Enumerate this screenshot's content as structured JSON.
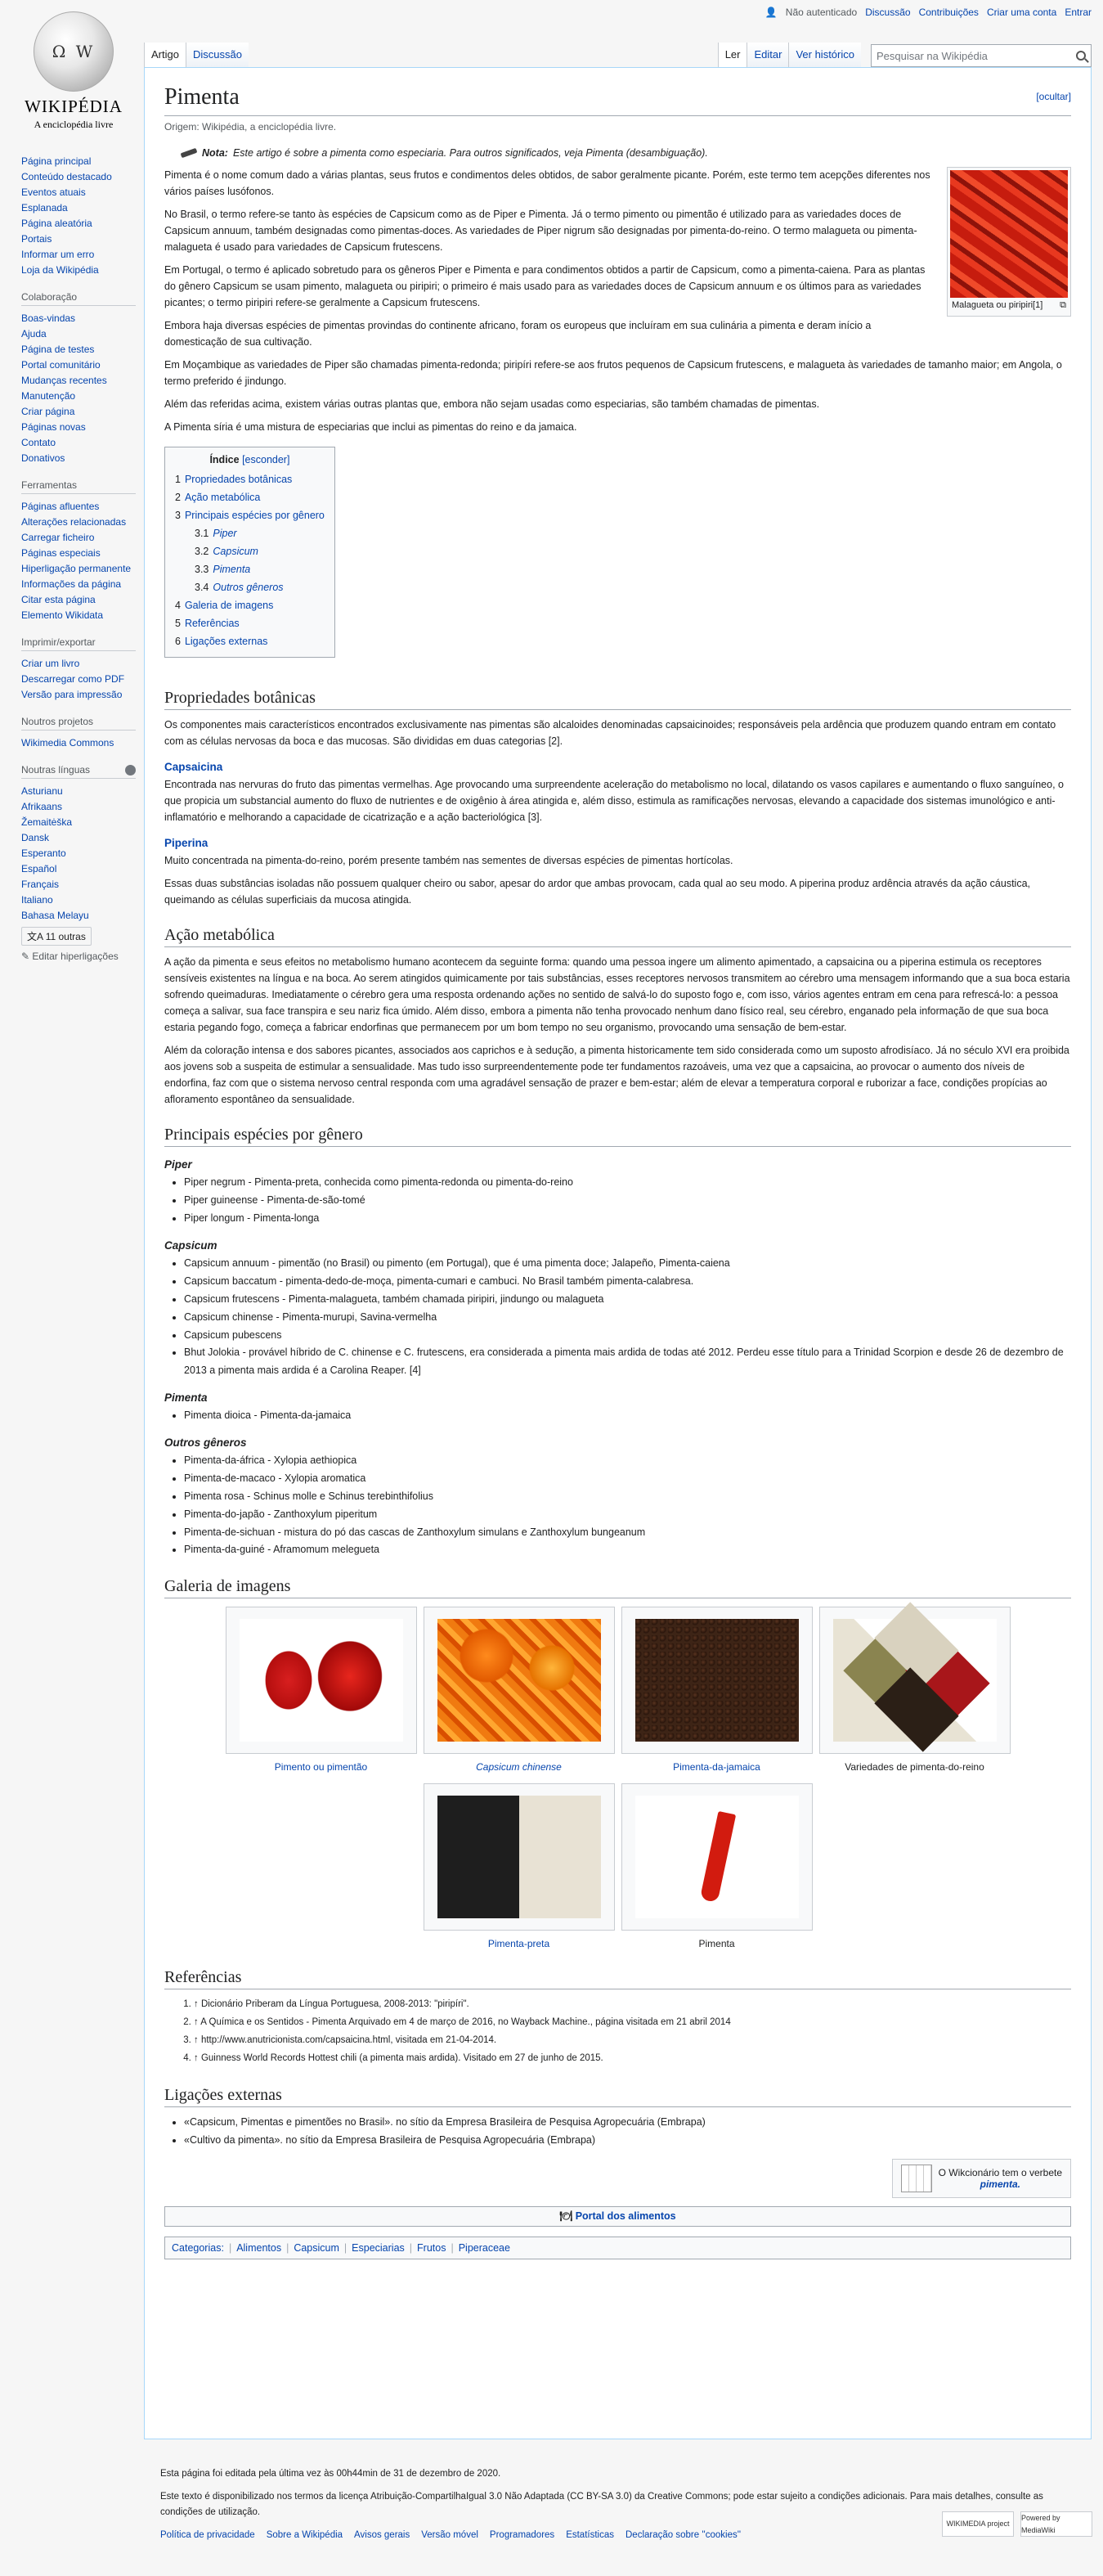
{
  "personal": {
    "not_logged": "Não autenticado",
    "discussion": "Discussão",
    "contributions": "Contribuições",
    "create_account": "Criar uma conta",
    "login": "Entrar"
  },
  "logo": {
    "name": "WIKIPÉDIA",
    "tagline": "A enciclopédia livre"
  },
  "sidebar": {
    "main": [
      "Página principal",
      "Conteúdo destacado",
      "Eventos atuais",
      "Esplanada",
      "Página aleatória",
      "Portais",
      "Informar um erro",
      "Loja da Wikipédia"
    ],
    "collab_title": "Colaboração",
    "collab": [
      "Boas-vindas",
      "Ajuda",
      "Página de testes",
      "Portal comunitário",
      "Mudanças recentes",
      "Manutenção",
      "Criar página",
      "Páginas novas",
      "Contato",
      "Donativos"
    ],
    "tools_title": "Ferramentas",
    "tools": [
      "Páginas afluentes",
      "Alterações relacionadas",
      "Carregar ficheiro",
      "Páginas especiais",
      "Hiperligação permanente",
      "Informações da página",
      "Citar esta página",
      "Elemento Wikidata"
    ],
    "print_title": "Imprimir/exportar",
    "print": [
      "Criar um livro",
      "Descarregar como PDF",
      "Versão para impressão"
    ],
    "projects_title": "Noutros projetos",
    "projects": [
      "Wikimedia Commons"
    ],
    "langs_title": "Noutras línguas",
    "langs": [
      "Asturianu",
      "Afrikaans",
      "Žemaitėška",
      "Dansk",
      "Esperanto",
      "Español",
      "Français",
      "Italiano",
      "Bahasa Melayu"
    ],
    "more_langs": "11 outras",
    "edit_links": "Editar hiperligações"
  },
  "tabs": {
    "article": "Artigo",
    "discussion": "Discussão",
    "read": "Ler",
    "edit": "Editar",
    "history": "Ver histórico",
    "search_placeholder": "Pesquisar na Wikipédia"
  },
  "title": "Pimenta",
  "hide": "[ocultar]",
  "sitesub": "Origem: Wikipédia, a enciclopédia livre.",
  "hatnote": {
    "label": "Nota:",
    "text": "Este artigo é sobre a pimenta como especiaria. Para outros significados, veja Pimenta (desambiguação)."
  },
  "infobox_caption": "Malagueta ou piripiri[1]",
  "intro": [
    "Pimenta é o nome comum dado a várias plantas, seus frutos e condimentos deles obtidos, de sabor geralmente picante. Porém, este termo tem acepções diferentes nos vários países lusófonos.",
    "No Brasil, o termo refere-se tanto às espécies de Capsicum como as de Piper e Pimenta. Já o termo pimento ou pimentão é utilizado para as variedades doces de Capsicum annuum, também designadas como pimentas-doces. As variedades de Piper nigrum são designadas por pimenta-do-reino. O termo malagueta ou pimenta-malagueta é usado para variedades de Capsicum frutescens.",
    "Em Portugal, o termo é aplicado sobretudo para os gêneros Piper e Pimenta e para condimentos obtidos a partir de Capsicum, como a pimenta-caiena. Para as plantas do gênero Capsicum se usam pimento, malagueta ou piripiri; o primeiro é mais usado para as variedades doces de Capsicum annuum e os últimos para as variedades picantes; o termo piripiri refere-se geralmente a Capsicum frutescens.",
    "Embora haja diversas espécies de pimentas provindas do continente africano, foram os europeus que incluíram em sua culinária a pimenta e deram início a domesticação de sua cultivação.",
    "Em Moçambique as variedades de Piper são chamadas pimenta-redonda; piripíri refere-se aos frutos pequenos de Capsicum frutescens, e malagueta às variedades de tamanho maior; em Angola, o termo preferido é jindungo.",
    "Além das referidas acima, existem várias outras plantas que, embora não sejam usadas como especiarias, são também chamadas de pimentas.",
    "A Pimenta síria é uma mistura de especiarias que inclui as pimentas do reino e da jamaica."
  ],
  "toc": {
    "title": "Índice",
    "toggle": "[esconder]",
    "items": [
      {
        "n": "1",
        "t": "Propriedades botânicas"
      },
      {
        "n": "2",
        "t": "Ação metabólica"
      },
      {
        "n": "3",
        "t": "Principais espécies por gênero"
      },
      {
        "n": "3.1",
        "t": "Piper"
      },
      {
        "n": "3.2",
        "t": "Capsicum"
      },
      {
        "n": "3.3",
        "t": "Pimenta"
      },
      {
        "n": "3.4",
        "t": "Outros gêneros"
      },
      {
        "n": "4",
        "t": "Galeria de imagens"
      },
      {
        "n": "5",
        "t": "Referências"
      },
      {
        "n": "6",
        "t": "Ligações externas"
      }
    ]
  },
  "s1": {
    "title": "Propriedades botânicas",
    "p1": "Os componentes mais característicos encontrados exclusivamente nas pimentas são alcaloides denominadas capsaicinoides; responsáveis pela ardência que produzem quando entram em contato com as células nervosas da boca e das mucosas. São divididas em duas categorias [2].",
    "h_caps": "Capsaicina",
    "p_caps": "Encontrada nas nervuras do fruto das pimentas vermelhas. Age provocando uma surpreendente aceleração do metabolismo no local, dilatando os vasos capilares e aumentando o fluxo sanguíneo, o que propicia um substancial aumento do fluxo de nutrientes e de oxigênio à área atingida e, além disso, estimula as ramificações nervosas, elevando a capacidade dos sistemas imunológico e anti-inflamatório e melhorando a capacidade de cicatrização e a ação bacteriológica [3].",
    "h_pip": "Piperina",
    "p_pip1": "Muito concentrada na pimenta-do-reino, porém presente também nas sementes de diversas espécies de pimentas hortícolas.",
    "p_pip2": "Essas duas substâncias isoladas não possuem qualquer cheiro ou sabor, apesar do ardor que ambas provocam, cada qual ao seu modo. A piperina produz ardência através da ação cáustica, queimando as células superficiais da mucosa atingida."
  },
  "s2": {
    "title": "Ação metabólica",
    "p1": "A ação da pimenta e seus efeitos no metabolismo humano acontecem da seguinte forma: quando uma pessoa ingere um alimento apimentado, a capsaicina ou a piperina estimula os receptores sensíveis existentes na língua e na boca. Ao serem atingidos quimicamente por tais substâncias, esses receptores nervosos transmitem ao cérebro uma mensagem informando que a sua boca estaria sofrendo queimaduras. Imediatamente o cérebro gera uma resposta ordenando ações no sentido de salvá-lo do suposto fogo e, com isso, vários agentes entram em cena para refrescá-lo: a pessoa começa a salivar, sua face transpira e seu nariz fica úmido. Além disso, embora a pimenta não tenha provocado nenhum dano físico real, seu cérebro, enganado pela informação de que sua boca estaria pegando fogo, começa a fabricar endorfinas que permanecem por um bom tempo no seu organismo, provocando uma sensação de bem-estar.",
    "p2": "Além da coloração intensa e dos sabores picantes, associados aos caprichos e à sedução, a pimenta historicamente tem sido considerada como um suposto afrodisíaco. Já no século XVI era proibida aos jovens sob a suspeita de estimular a sensualidade. Mas tudo isso surpreendentemente pode ter fundamentos razoáveis, uma vez que a capsaicina, ao provocar o aumento dos níveis de endorfina, faz com que o sistema nervoso central responda com uma agradável sensação de prazer e bem-estar; além de elevar a temperatura corporal e ruborizar a face, condições propícias ao afloramento espontâneo da sensualidade."
  },
  "s3": {
    "title": "Principais espécies por gênero",
    "piper": {
      "h": "Piper",
      "items": [
        "Piper negrum - Pimenta-preta, conhecida como pimenta-redonda ou pimenta-do-reino",
        "Piper guineense - Pimenta-de-são-tomé",
        "Piper longum - Pimenta-longa"
      ]
    },
    "capsicum": {
      "h": "Capsicum",
      "items": [
        "Capsicum annuum - pimentão (no Brasil) ou pimento (em Portugal), que é uma pimenta doce; Jalapeño, Pimenta-caiena",
        "Capsicum baccatum - pimenta-dedo-de-moça, pimenta-cumari e cambuci. No Brasil também pimenta-calabresa.",
        "Capsicum frutescens - Pimenta-malagueta, também chamada piripiri, jindungo ou malagueta",
        "Capsicum chinense - Pimenta-murupi, Savina-vermelha",
        "Capsicum pubescens",
        "Bhut Jolokia - provável híbrido de C. chinense e C. frutescens, era considerada a pimenta mais ardida de todas até 2012. Perdeu esse título para a Trinidad Scorpion e desde 26 de dezembro de 2013 a pimenta mais ardida é a Carolina Reaper. [4]"
      ]
    },
    "pimenta": {
      "h": "Pimenta",
      "items": [
        "Pimenta dioica - Pimenta-da-jamaica"
      ]
    },
    "outros": {
      "h": "Outros gêneros",
      "items": [
        "Pimenta-da-áfrica - Xylopia aethiopica",
        "Pimenta-de-macaco - Xylopia aromatica",
        "Pimenta rosa - Schinus molle e Schinus terebinthifolius",
        "Pimenta-do-japão - Zanthoxylum piperitum",
        "Pimenta-de-sichuan - mistura do pó das cascas de Zanthoxylum simulans e Zanthoxylum bungeanum",
        "Pimenta-da-guiné - Aframomum melegueta"
      ]
    }
  },
  "gallery": {
    "title": "Galeria de imagens",
    "items": [
      "Pimento ou pimentão",
      "Capsicum chinense",
      "Pimenta-da-jamaica",
      "Variedades de pimenta-do-reino",
      "Pimenta-preta",
      "Pimenta"
    ]
  },
  "refs": {
    "title": "Referências",
    "items": [
      "↑ Dicionário Priberam da Língua Portuguesa, 2008-2013: \"piripíri\".",
      "↑ A Química e os Sentidos - Pimenta Arquivado em 4 de março de 2016, no Wayback Machine., página visitada em 21 abril 2014",
      "↑ http://www.anutricionista.com/capsaicina.html, visitada em 21-04-2014.",
      "↑ Guinness World Records Hottest chili (a pimenta mais ardida). Visitado em 27 de junho de 2015."
    ]
  },
  "ext": {
    "title": "Ligações externas",
    "items": [
      "«Capsicum, Pimentas e pimentões no Brasil». no sítio da Empresa Brasileira de Pesquisa Agropecuária (Embrapa)",
      "«Cultivo da pimenta». no sítio da Empresa Brasileira de Pesquisa Agropecuária (Embrapa)"
    ]
  },
  "wiktionary": {
    "line1": "O Wikcionário tem o verbete",
    "word": "pimenta."
  },
  "navbox": "Portal dos alimentos",
  "cats": {
    "label": "Categorias:",
    "items": [
      "Alimentos",
      "Capsicum",
      "Especiarias",
      "Frutos",
      "Piperaceae"
    ]
  },
  "footer": {
    "edited": "Esta página foi editada pela última vez às 00h44min de 31 de dezembro de 2020.",
    "license": "Este texto é disponibilizado nos termos da licença Atribuição-CompartilhaIgual 3.0 Não Adaptada (CC BY-SA 3.0) da Creative Commons; pode estar sujeito a condições adicionais. Para mais detalhes, consulte as condições de utilização.",
    "links": [
      "Política de privacidade",
      "Sobre a Wikipédia",
      "Avisos gerais",
      "Versão móvel",
      "Programadores",
      "Estatísticas",
      "Declaração sobre ''cookies''"
    ],
    "badge1": "WIKIMEDIA project",
    "badge2": "Powered by MediaWiki"
  }
}
